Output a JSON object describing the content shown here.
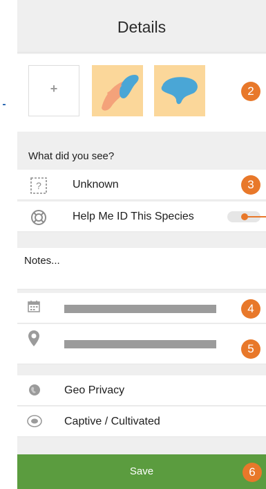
{
  "header": {
    "title": "Details"
  },
  "photos": {
    "add_icon": "plus-icon"
  },
  "badges": {
    "photos": "2",
    "identification": "3",
    "date": "4",
    "location": "5",
    "save": "6"
  },
  "identification": {
    "label": "What did you see?",
    "unknown": {
      "label": "Unknown",
      "icon": "question-box-icon"
    },
    "help": {
      "label": "Help Me ID This Species",
      "icon": "life-ring-icon",
      "toggle_on": true
    }
  },
  "notes": {
    "placeholder": "Notes..."
  },
  "date": {
    "icon": "calendar-icon"
  },
  "location": {
    "icon": "location-pin-icon"
  },
  "geo_privacy": {
    "label": "Geo Privacy",
    "icon": "globe-icon"
  },
  "captive": {
    "label": "Captive / Cultivated",
    "icon": "captive-icon"
  },
  "footer": {
    "save_label": "Save"
  },
  "colors": {
    "accent": "#e8782a",
    "save": "#5b9c3f",
    "thumb_bg": "#fbd79a",
    "bird_blue": "#4aa6d6",
    "bird_orange": "#f4a27a"
  }
}
